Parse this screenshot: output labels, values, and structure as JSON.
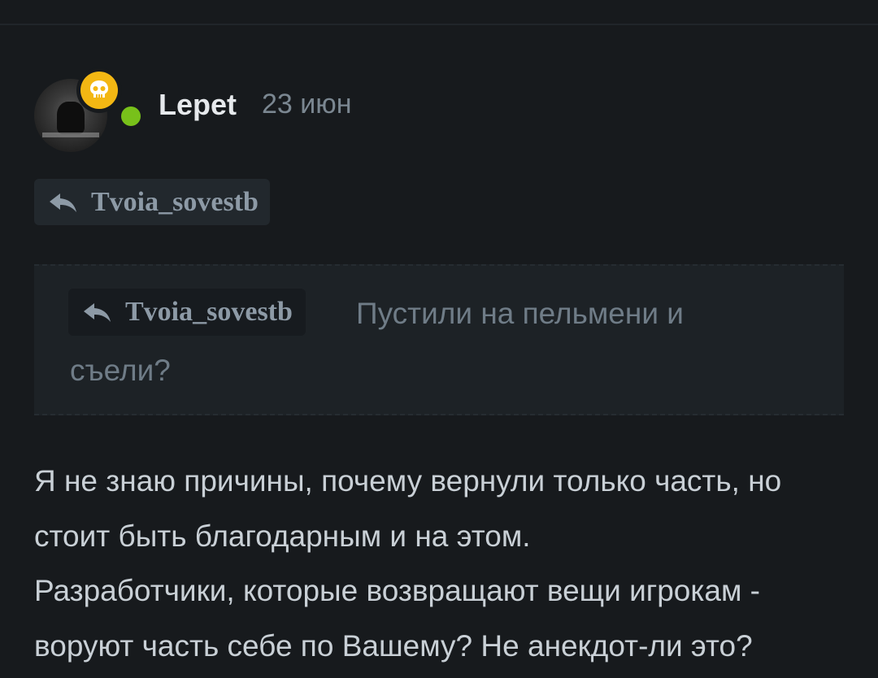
{
  "comment": {
    "author": "Lepet",
    "date": "23 июн",
    "author_status": "online",
    "badge_icon": "skull-icon",
    "reply_to": "Tvoia_sovestb",
    "quote": {
      "reply_to": "Tvoia_sovestb",
      "text_line1": "Пустили на пельмени и",
      "text_line2": "съели?"
    },
    "body_lines": [
      "Я не знаю причины, почему вернули только часть, но",
      "стоит быть благодарным и на этом.",
      "Разработчики, которые возвращают вещи игрокам -",
      "воруют часть себе по Вашему? Не анекдот-ли это?"
    ]
  },
  "colors": {
    "background": "#171a1d",
    "badge_yellow": "#f3b713",
    "online_green": "#78c11a",
    "username": "#e6e9ec",
    "muted": "#7b8791",
    "body_text": "#c9d0d6"
  }
}
